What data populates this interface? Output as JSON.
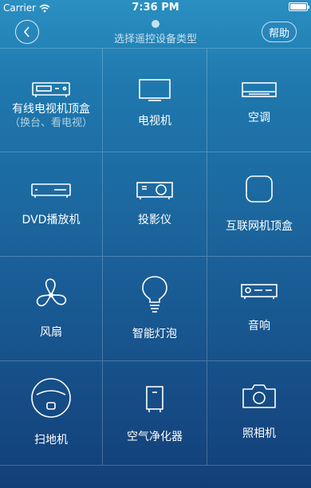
{
  "status_bar": {
    "carrier": "Carrier",
    "time": "7:36 PM",
    "battery_level": 1.0
  },
  "nav": {
    "title": "选择遥控设备类型",
    "help_label": "帮助"
  },
  "devices": [
    {
      "label": "有线电视机顶盒",
      "sub": "（换台、看电视）",
      "icon": "set-top-box-icon"
    },
    {
      "label": "电视机",
      "icon": "tv-icon"
    },
    {
      "label": "空调",
      "icon": "air-conditioner-icon"
    },
    {
      "label": "DVD播放机",
      "icon": "dvd-player-icon"
    },
    {
      "label": "投影仪",
      "icon": "projector-icon"
    },
    {
      "label": "互联网机顶盒",
      "icon": "internet-box-icon"
    },
    {
      "label": "风扇",
      "icon": "fan-icon"
    },
    {
      "label": "智能灯泡",
      "icon": "light-bulb-icon"
    },
    {
      "label": "音响",
      "icon": "speaker-icon"
    },
    {
      "label": "扫地机",
      "icon": "robot-vacuum-icon"
    },
    {
      "label": "空气净化器",
      "icon": "air-purifier-icon"
    },
    {
      "label": "照相机",
      "icon": "camera-icon"
    }
  ],
  "colors": {
    "bg_top": "#2a8fc2",
    "bg_bottom": "#133f78",
    "grid_line": "rgba(255,255,255,0.22)"
  }
}
